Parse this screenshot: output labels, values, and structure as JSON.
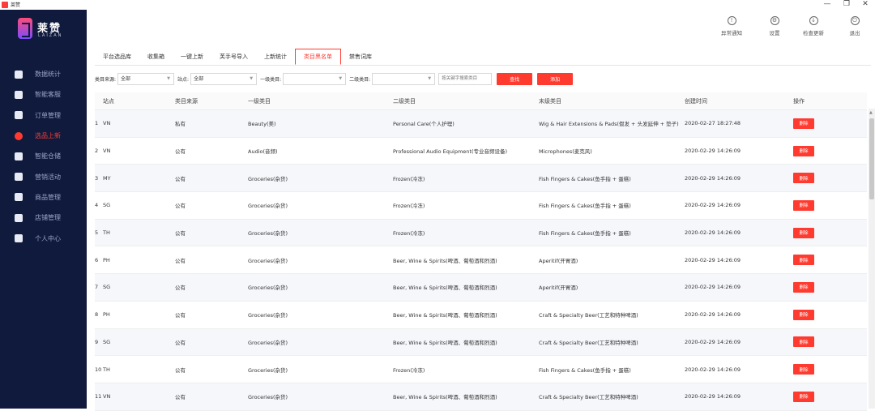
{
  "window": {
    "title": "莱赞",
    "controls": [
      "—",
      "❐",
      "✕"
    ]
  },
  "brand": {
    "name": "莱赞",
    "sub": "LAIZAN"
  },
  "sidebar": {
    "items": [
      {
        "label": "数据统计",
        "icon": "chart-pie-icon"
      },
      {
        "label": "智能客服",
        "icon": "headset-icon"
      },
      {
        "label": "订单管理",
        "icon": "order-list-icon"
      },
      {
        "label": "选品上新",
        "icon": "new-badge-icon",
        "active": true
      },
      {
        "label": "智能仓储",
        "icon": "warehouse-icon"
      },
      {
        "label": "营销活动",
        "icon": "marketing-icon"
      },
      {
        "label": "商品管理",
        "icon": "product-icon"
      },
      {
        "label": "店铺管理",
        "icon": "store-icon"
      },
      {
        "label": "个人中心",
        "icon": "user-icon"
      }
    ]
  },
  "tools": [
    {
      "label": "异常通知",
      "icon": "warning-icon",
      "glyph": "!"
    },
    {
      "label": "设置",
      "icon": "gear-icon",
      "glyph": "⚙"
    },
    {
      "label": "检查更新",
      "icon": "download-icon",
      "glyph": "↓"
    },
    {
      "label": "退出",
      "icon": "power-icon",
      "glyph": "⏻"
    }
  ],
  "tabs": [
    {
      "label": "平台选品库"
    },
    {
      "label": "收集箱"
    },
    {
      "label": "一键上新"
    },
    {
      "label": "芙手号导入"
    },
    {
      "label": "上新统计"
    },
    {
      "label": "类目黑名单",
      "active": true
    },
    {
      "label": "禁售词库"
    }
  ],
  "filters": {
    "source_label": "类目来源:",
    "source_value": "全部",
    "site_label": "站点:",
    "site_value": "全部",
    "level1_label": "一级类目:",
    "level1_value": "",
    "level2_label": "二级类目:",
    "level2_value": "",
    "keyword_placeholder": "按关键字搜索类目",
    "search_button": "查找",
    "add_button": "添加"
  },
  "table": {
    "headers": {
      "site": "站点",
      "source": "类目来源",
      "level1": "一级类目",
      "level2": "二级类目",
      "leaf": "末级类目",
      "created": "创建时间",
      "ops": "操作"
    },
    "delete_label": "删除",
    "rows": [
      {
        "idx": "1",
        "site": "VN",
        "source": "私有",
        "level1": "Beauty(美)",
        "level2": "Personal Care(个人护理)",
        "leaf": "Wig & Hair Extensions & Pads(假发 + 头发延伸 + 垫子)",
        "created": "2020-02-27 18:27:48"
      },
      {
        "idx": "2",
        "site": "VN",
        "source": "公有",
        "level1": "Audio(音频)",
        "level2": "Professional Audio Equipment(专业音频设备)",
        "leaf": "Microphones(麦克风)",
        "created": "2020-02-29 14:26:09"
      },
      {
        "idx": "3",
        "site": "MY",
        "source": "公有",
        "level1": "Groceries(杂货)",
        "level2": "Frozen(冷冻)",
        "leaf": "Fish Fingers & Cakes(鱼手指 + 蛋糕)",
        "created": "2020-02-29 14:26:09"
      },
      {
        "idx": "4",
        "site": "SG",
        "source": "公有",
        "level1": "Groceries(杂货)",
        "level2": "Frozen(冷冻)",
        "leaf": "Fish Fingers & Cakes(鱼手指 + 蛋糕)",
        "created": "2020-02-29 14:26:09"
      },
      {
        "idx": "5",
        "site": "TH",
        "source": "公有",
        "level1": "Groceries(杂货)",
        "level2": "Frozen(冷冻)",
        "leaf": "Fish Fingers & Cakes(鱼手指 + 蛋糕)",
        "created": "2020-02-29 14:26:09"
      },
      {
        "idx": "6",
        "site": "PH",
        "source": "公有",
        "level1": "Groceries(杂货)",
        "level2": "Beer, Wine & Spirits(啤酒、葡萄酒和烈酒)",
        "leaf": "Aperitif(开胃酒)",
        "created": "2020-02-29 14:26:09"
      },
      {
        "idx": "7",
        "site": "SG",
        "source": "公有",
        "level1": "Groceries(杂货)",
        "level2": "Beer, Wine & Spirits(啤酒、葡萄酒和烈酒)",
        "leaf": "Aperitif(开胃酒)",
        "created": "2020-02-29 14:26:09"
      },
      {
        "idx": "8",
        "site": "PH",
        "source": "公有",
        "level1": "Groceries(杂货)",
        "level2": "Beer, Wine & Spirits(啤酒、葡萄酒和烈酒)",
        "leaf": "Craft & Specialty Beer(工艺和特种啤酒)",
        "created": "2020-02-29 14:26:09"
      },
      {
        "idx": "9",
        "site": "SG",
        "source": "公有",
        "level1": "Groceries(杂货)",
        "level2": "Beer, Wine & Spirits(啤酒、葡萄酒和烈酒)",
        "leaf": "Craft & Specialty Beer(工艺和特种啤酒)",
        "created": "2020-02-29 14:26:09"
      },
      {
        "idx": "10",
        "site": "TH",
        "source": "公有",
        "level1": "Groceries(杂货)",
        "level2": "Frozen(冷冻)",
        "leaf": "Fish Fingers & Cakes(鱼手指 + 蛋糕)",
        "created": "2020-02-29 14:26:09"
      },
      {
        "idx": "11",
        "site": "VN",
        "source": "公有",
        "level1": "Groceries(杂货)",
        "level2": "Beer, Wine & Spirits(啤酒、葡萄酒和烈酒)",
        "leaf": "Craft & Specialty Beer(工艺和特种啤酒)",
        "created": "2020-02-29 14:26:09"
      }
    ]
  },
  "colors": {
    "accent": "#ff3b30",
    "sidebar_bg": "#0f1a3c",
    "sidebar_text": "#9aa3c7"
  }
}
